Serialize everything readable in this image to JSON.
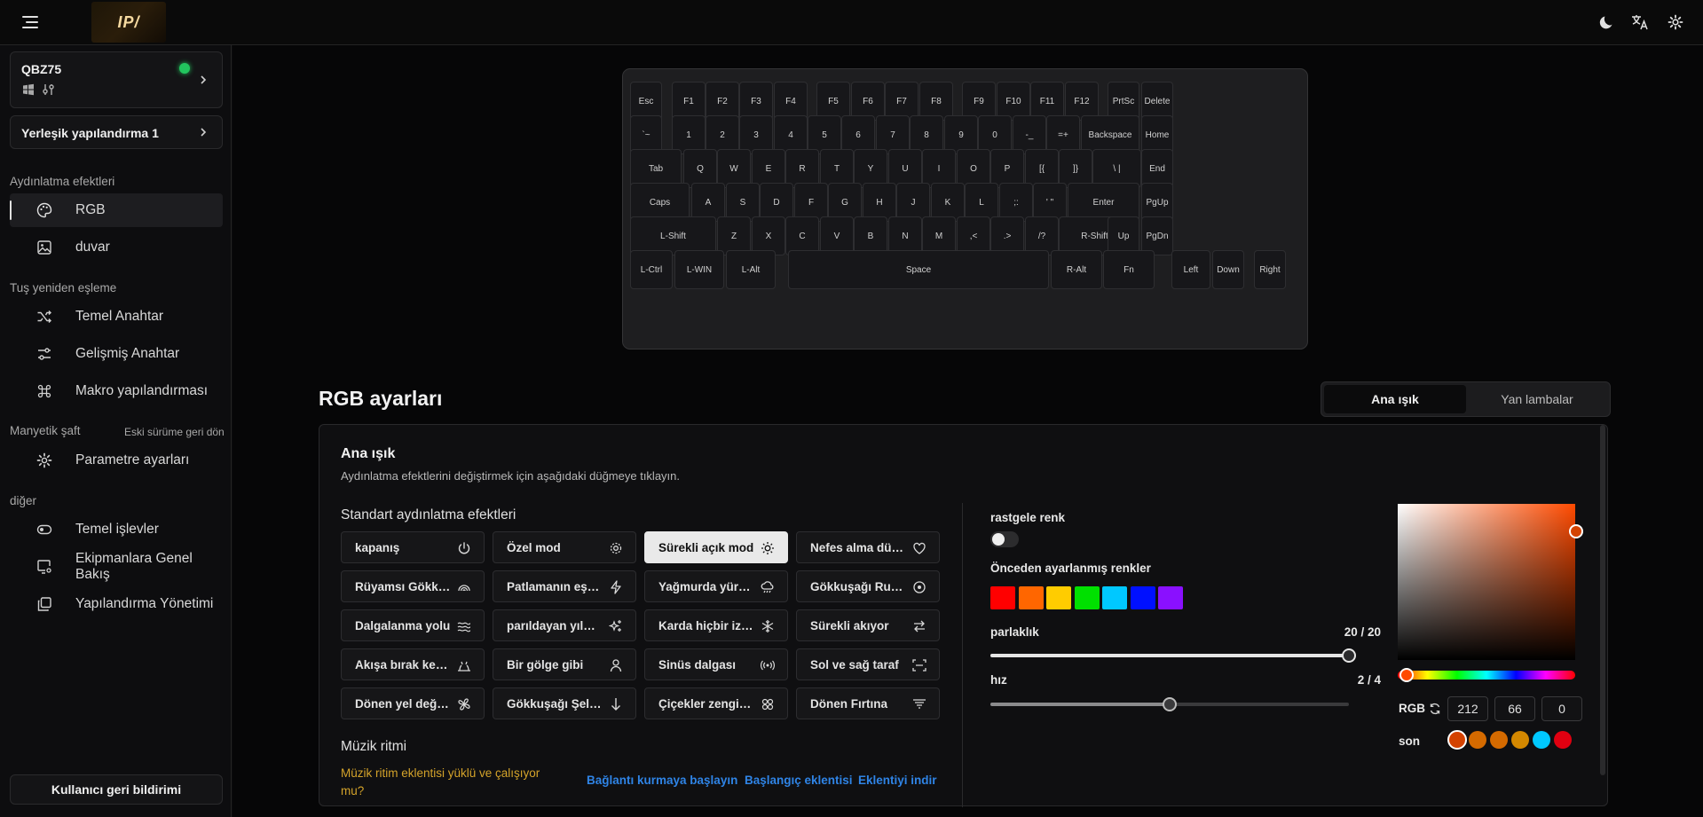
{
  "app": {
    "logo_text": "IP/"
  },
  "device": {
    "name": "QBZ75",
    "status_color": "#22c55e"
  },
  "config": {
    "label": "Yerleşik yapılandırma 1"
  },
  "sidebar": {
    "sections": [
      {
        "title": "Aydınlatma efektleri"
      },
      {
        "title": "Tuş yeniden eşleme"
      },
      {
        "title": "Manyetik şaft",
        "extra": "Eski sürüme geri dön"
      },
      {
        "title": "diğer"
      }
    ],
    "items": [
      {
        "label": "RGB",
        "icon": "palette-icon"
      },
      {
        "label": "duvar",
        "icon": "image-icon"
      },
      {
        "label": "Temel Anahtar",
        "icon": "shuffle-icon"
      },
      {
        "label": "Gelişmiş Anahtar",
        "icon": "sliders-icon"
      },
      {
        "label": "Makro yapılandırması",
        "icon": "command-icon"
      },
      {
        "label": "Parametre ayarları",
        "icon": "gear-icon"
      },
      {
        "label": "Temel işlevler",
        "icon": "toggle-icon"
      },
      {
        "label": "Ekipmanlara Genel Bakış",
        "icon": "monitor-gear-icon"
      },
      {
        "label": "Yapılandırma Yönetimi",
        "icon": "copy-icon"
      }
    ],
    "feedback_label": "Kullanıcı geri bildirimi"
  },
  "keyboard": {
    "rows": [
      [
        "Esc",
        "F1",
        "F2",
        "F3",
        "F4",
        "F5",
        "F6",
        "F7",
        "F8",
        "F9",
        "F10",
        "F11",
        "F12",
        "PrtSc",
        "Delete"
      ],
      [
        "`~",
        "1",
        "2",
        "3",
        "4",
        "5",
        "6",
        "7",
        "8",
        "9",
        "0",
        "-_",
        "=+",
        "Backspace",
        "Home"
      ],
      [
        "Tab",
        "Q",
        "W",
        "E",
        "R",
        "T",
        "Y",
        "U",
        "I",
        "O",
        "P",
        "[{",
        "]}",
        "\\ |",
        "End"
      ],
      [
        "Caps",
        "A",
        "S",
        "D",
        "F",
        "G",
        "H",
        "J",
        "K",
        "L",
        ";:",
        "' \"",
        "Enter",
        "PgUp"
      ],
      [
        "L-Shift",
        "Z",
        "X",
        "C",
        "V",
        "B",
        "N",
        "M",
        ",<",
        ".>",
        "/?",
        "R-Shift",
        "Up",
        "PgDn"
      ],
      [
        "L-Ctrl",
        "L-WIN",
        "L-Alt",
        "Space",
        "R-Alt",
        "Fn",
        "Left",
        "Down",
        "Right"
      ]
    ]
  },
  "rgb": {
    "title": "RGB ayarları",
    "tabs": [
      "Ana ışık",
      "Yan lambalar"
    ],
    "panel_title": "Ana ışık",
    "panel_subtitle": "Aydınlatma efektlerini değiştirmek için aşağıdaki düğmeye tıklayın.",
    "standard_title": "Standart aydınlatma efektleri",
    "effects": [
      {
        "label": "kapanış",
        "icon": "power-icon"
      },
      {
        "label": "Özel mod",
        "icon": "gear-icon"
      },
      {
        "label": "Sürekli açık mod",
        "icon": "sun-icon",
        "selected": true
      },
      {
        "label": "Nefes alma düzeni",
        "icon": "heart-icon"
      },
      {
        "label": "Rüyamsı Gökkuşağı",
        "icon": "rainbow-icon"
      },
      {
        "label": "Patlamanın eşiğinde",
        "icon": "bolt-icon"
      },
      {
        "label": "Yağmurda yürümek",
        "icon": "rain-cloud-icon"
      },
      {
        "label": "Gökkuşağı Ruleti",
        "icon": "target-icon"
      },
      {
        "label": "Dalgalanma yolu",
        "icon": "waves-icon"
      },
      {
        "label": "parıldayan yıldızlar",
        "icon": "sparkles-icon"
      },
      {
        "label": "Karda hiçbir iz yok",
        "icon": "snowflake-icon"
      },
      {
        "label": "Sürekli akıyor",
        "icon": "arrows-icon"
      },
      {
        "label": "Akışa bırak kendini",
        "icon": "ripple-icon"
      },
      {
        "label": "Bir gölge gibi",
        "icon": "person-icon"
      },
      {
        "label": "Sinüs dalgası",
        "icon": "broadcast-icon"
      },
      {
        "label": "Sol ve sağ taraf",
        "icon": "scan-icon"
      },
      {
        "label": "Dönen yel değirmeni",
        "icon": "windmill-icon"
      },
      {
        "label": "Gökkuşağı Şelalesi",
        "icon": "arrow-down-icon"
      },
      {
        "label": "Çiçekler zenginleşir",
        "icon": "flower-icon"
      },
      {
        "label": "Dönen Fırtına",
        "icon": "filter-icon"
      }
    ],
    "music_title": "Müzik ritmi",
    "music_warning": "Müzik ritim eklentisi yüklü ve çalışıyor mu?",
    "music_links": [
      "Bağlantı kurmaya başlayın",
      "Başlangıç eklentisi",
      "Eklentiyi indir"
    ],
    "random_color_label": "rastgele renk",
    "random_color_on": false,
    "preset_label": "Önceden ayarlanmış renkler",
    "presets": [
      "#ff0000",
      "#ff6600",
      "#ffcc00",
      "#00e000",
      "#00c8ff",
      "#0010ff",
      "#8a10ff"
    ],
    "brightness_label": "parlaklık",
    "brightness_value": "20 / 20",
    "brightness_fraction": 1.0,
    "speed_label": "hız",
    "speed_value": "2 / 4",
    "speed_fraction": 0.5,
    "rgb_label": "RGB",
    "r": "212",
    "g": "66",
    "b": "0",
    "recent_label": "son",
    "recent_colors": [
      "#d44200",
      "#d46a00",
      "#d46a00",
      "#d48800",
      "#00c8ff",
      "#e00010"
    ],
    "current_color": "#d44200"
  },
  "colors": {
    "accent_green": "#22c55e",
    "link_blue": "#2f84e6",
    "warning_yellow": "#d4a32a"
  }
}
